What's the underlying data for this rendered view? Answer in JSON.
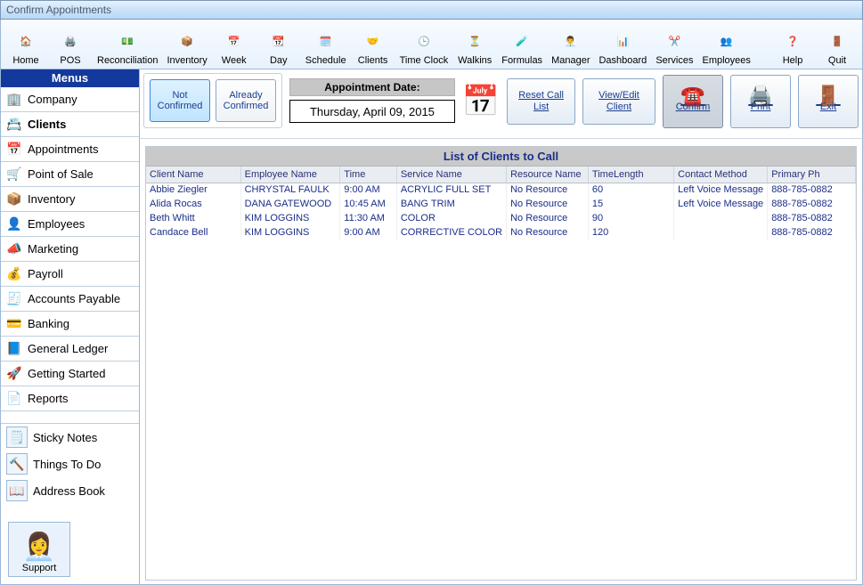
{
  "window": {
    "title": "Confirm Appointments"
  },
  "toolbar": [
    {
      "label": "Home",
      "icon": "🏠"
    },
    {
      "label": "POS",
      "icon": "🖨️"
    },
    {
      "label": "Reconciliation",
      "icon": "💵"
    },
    {
      "label": "Inventory",
      "icon": "📦"
    },
    {
      "label": "Week",
      "icon": "📅"
    },
    {
      "label": "Day",
      "icon": "📆"
    },
    {
      "label": "Schedule",
      "icon": "🗓️"
    },
    {
      "label": "Clients",
      "icon": "🤝"
    },
    {
      "label": "Time Clock",
      "icon": "🕒"
    },
    {
      "label": "Walkins",
      "icon": "⏳"
    },
    {
      "label": "Formulas",
      "icon": "🧪"
    },
    {
      "label": "Manager",
      "icon": "👨‍💼"
    },
    {
      "label": "Dashboard",
      "icon": "📊"
    },
    {
      "label": "Services",
      "icon": "✂️"
    },
    {
      "label": "Employees",
      "icon": "👥"
    },
    {
      "label": "Help",
      "icon": "❓"
    },
    {
      "label": "Quit",
      "icon": "🚪"
    }
  ],
  "sidebar": {
    "header": "Menus",
    "items": [
      {
        "label": "Company",
        "icon": "🏢"
      },
      {
        "label": "Clients",
        "icon": "📇",
        "bold": true
      },
      {
        "label": "Appointments",
        "icon": "📅"
      },
      {
        "label": "Point of Sale",
        "icon": "🛒"
      },
      {
        "label": "Inventory",
        "icon": "📦"
      },
      {
        "label": "Employees",
        "icon": "👤"
      },
      {
        "label": "Marketing",
        "icon": "📣"
      },
      {
        "label": "Payroll",
        "icon": "💰"
      },
      {
        "label": "Accounts Payable",
        "icon": "🧾"
      },
      {
        "label": "Banking",
        "icon": "💳"
      },
      {
        "label": "General Ledger",
        "icon": "📘"
      },
      {
        "label": "Getting Started",
        "icon": "🚀"
      },
      {
        "label": "Reports",
        "icon": "📄"
      }
    ],
    "extras": [
      {
        "label": "Sticky Notes",
        "icon": "🗒️"
      },
      {
        "label": "Things To Do",
        "icon": "🔨"
      },
      {
        "label": "Address Book",
        "icon": "📖"
      }
    ],
    "support": {
      "label": "Support",
      "icon": "👩‍💼"
    }
  },
  "filters": {
    "notConfirmed": "Not Confirmed",
    "alreadyConfirmed": "Already Confirmed",
    "dateHeader": "Appointment Date:",
    "dateValue": "Thursday, April 09, 2015",
    "resetCallList": "Reset Call List",
    "viewEditClient": "View/Edit Client",
    "confirm": "Confirm",
    "print": "Print",
    "exit": "Exit"
  },
  "table": {
    "title": "List of Clients to Call",
    "columns": [
      "Client Name",
      "Employee Name",
      "Time",
      "Service Name",
      "Resource Name",
      "TimeLength",
      "Contact Method",
      "Primary Ph"
    ],
    "rows": [
      [
        "Abbie Ziegler",
        "CHRYSTAL FAULK",
        "9:00 AM",
        "ACRYLIC FULL SET",
        "No Resource",
        "60",
        "Left Voice Message",
        "888-785-0882"
      ],
      [
        "Alida Rocas",
        "DANA GATEWOOD",
        "10:45 AM",
        "BANG TRIM",
        "No Resource",
        "15",
        "Left Voice Message",
        "888-785-0882"
      ],
      [
        "Beth Whitt",
        "KIM LOGGINS",
        "11:30 AM",
        "COLOR",
        "No Resource",
        "90",
        "",
        "888-785-0882"
      ],
      [
        "Candace Bell",
        "KIM LOGGINS",
        "9:00 AM",
        "CORRECTIVE COLOR",
        "No Resource",
        "120",
        "",
        "888-785-0882"
      ]
    ]
  }
}
